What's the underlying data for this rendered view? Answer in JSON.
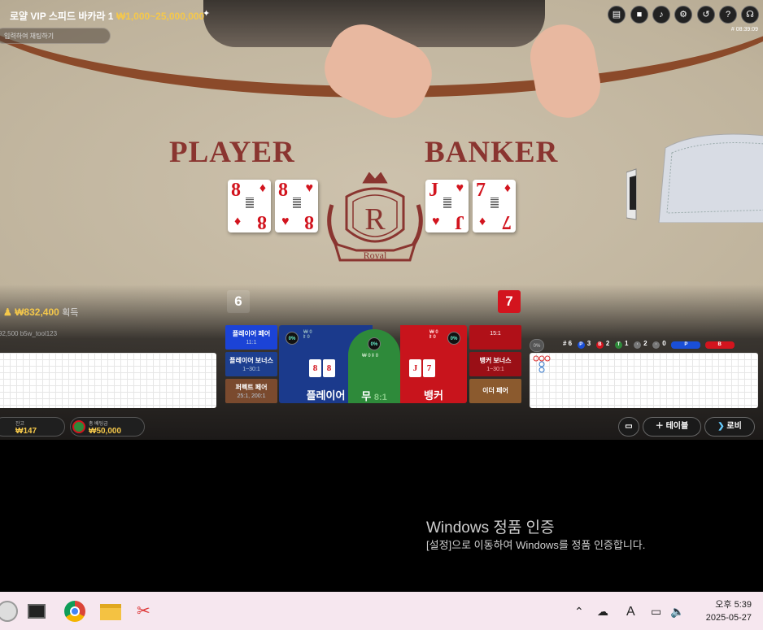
{
  "header": {
    "table_name": "로얄 VIP 스피드 바카라 1",
    "limits": "₩1,000~25,000,000",
    "pin_icon": "pin-icon",
    "chat_placeholder": "입력하여 채팅하기",
    "clock": "# 08:39:09",
    "buttons": [
      "chat-icon",
      "video-icon",
      "volume-icon",
      "settings-icon",
      "history-icon",
      "help-icon",
      "headset-icon"
    ]
  },
  "table": {
    "player_label": "PLAYER",
    "banker_label": "BANKER",
    "crest_letter": "R",
    "crest_ribbon": "Royal",
    "player_cards": [
      {
        "rank": "8",
        "suit": "♦"
      },
      {
        "rank": "8",
        "suit": "♥"
      }
    ],
    "banker_cards": [
      {
        "rank": "J",
        "suit": "♥"
      },
      {
        "rank": "7",
        "suit": "♦"
      }
    ],
    "player_score": "6",
    "banker_score": "7"
  },
  "winnings": {
    "amount": "₩832,400",
    "label": "획득",
    "user": "92,500 b5w_tool123"
  },
  "side_bets": {
    "player_pair": {
      "label": "플레이어 페어",
      "odds": "11:1"
    },
    "player_bonus": {
      "label": "플레이어 보너스",
      "odds": "1~30:1"
    },
    "perfect_pair": {
      "label": "퍼펙트 페어",
      "odds": "25:1, 200:1"
    },
    "banker_pair": {
      "label": "",
      "odds": "15:1"
    },
    "banker_bonus": {
      "label": "뱅커 보너스",
      "odds": "1~30:1"
    },
    "either_pair": {
      "label": "이더 페어",
      "odds": ""
    }
  },
  "main_bets": {
    "player": {
      "label": "플레이어",
      "pct": "0%",
      "w": "₩ 0",
      "o": "ꔪ 0"
    },
    "tie": {
      "label": "무",
      "odds": "8:1",
      "pct": "0%",
      "w": "₩ 0",
      "o": "ꔪ 0"
    },
    "banker": {
      "label": "뱅커",
      "pct": "0%",
      "w": "₩ 0",
      "o": "ꔪ 0"
    }
  },
  "stats": {
    "pct": "0%",
    "total": "# 6",
    "p": "3",
    "b": "2",
    "t": "1",
    "pp": "2",
    "bp": "0",
    "p_label": "P",
    "b_label": "B"
  },
  "balance": {
    "label": "잔고",
    "value": "₩147"
  },
  "total_bet": {
    "label": "총 배팅금",
    "value": "₩50,000"
  },
  "actions": {
    "tables": "테이블",
    "lobby": "로비"
  },
  "windows_activation": {
    "title": "Windows 정품 인증",
    "subtitle": "[설정]으로 이동하여 Windows를 정품 인증합니다."
  },
  "taskbar": {
    "time": "오후 5:39",
    "date": "2025-05-27",
    "ime": "A"
  }
}
